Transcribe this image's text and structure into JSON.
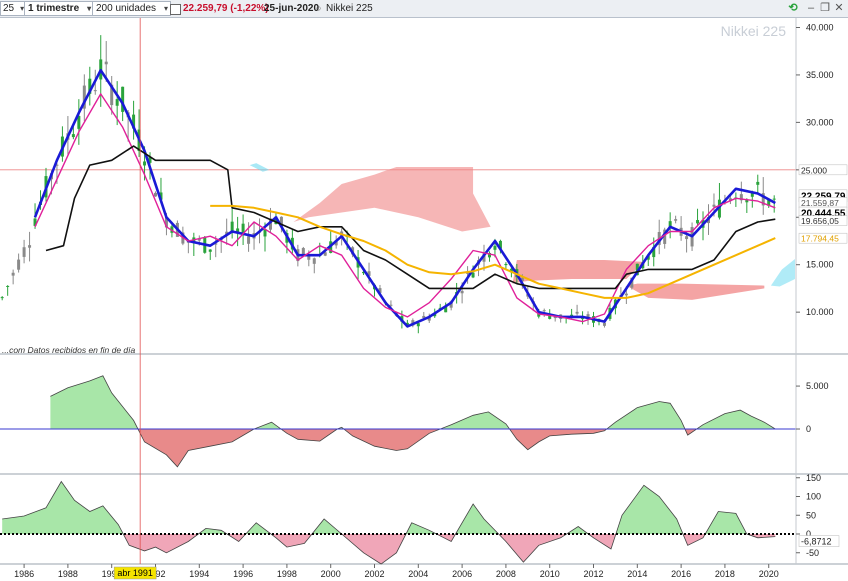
{
  "toolbar": {
    "prefix": "25",
    "period": "1 trimestre",
    "units": "200 unidades",
    "quote": "22.259,79 (-1,22%)",
    "date": "25-jun-2020",
    "instrument": "Nikkei 225"
  },
  "chart_data": [
    {
      "type": "line",
      "title": "Nikkei 225",
      "note": "...com  Datos recibidos en fin de día",
      "x_ticks": [
        "1986",
        "1988",
        "1990",
        "1992",
        "1994",
        "1996",
        "1998",
        "2000",
        "2002",
        "2004",
        "2006",
        "2008",
        "2010",
        "2012",
        "2014",
        "2016",
        "2018",
        "2020"
      ],
      "cursor_label": "abr 1991",
      "ylim": [
        5800,
        41000
      ],
      "y_ticks": [
        "40.000",
        "35.000",
        "30.000",
        "25.000",
        "20.000",
        "15.000",
        "10.000"
      ],
      "horizontal_line": 25000,
      "price_labels": [
        {
          "text": "25.000",
          "value": 25000,
          "bg": "#ffffff",
          "fg": "#222222"
        },
        {
          "text": "22.259,79",
          "value": 22260,
          "bg": "#ffffff",
          "fg": "#000000",
          "bold": true
        },
        {
          "text": "21.559,87",
          "value": 21560,
          "bg": "#ffffff",
          "fg": "#555555"
        },
        {
          "text": "20.444,55",
          "value": 20445,
          "bg": "#ffffff",
          "fg": "#000000",
          "bold": true
        },
        {
          "text": "19.656,05",
          "value": 19656,
          "bg": "#ffffff",
          "fg": "#333333"
        },
        {
          "text": "17.794,45",
          "value": 17794,
          "bg": "#ffffff",
          "fg": "#e0a000"
        }
      ],
      "series": [
        {
          "color": "#1a1ad6",
          "values": [
            [
              1986.5,
              20000
            ],
            [
              1987.5,
              26000
            ],
            [
              1988.5,
              31000
            ],
            [
              1989.5,
              35500
            ],
            [
              1990.5,
              32000
            ],
            [
              1991.5,
              27000
            ],
            [
              1992.5,
              20000
            ],
            [
              1993.5,
              17500
            ],
            [
              1994.5,
              17000
            ],
            [
              1995.5,
              18500
            ],
            [
              1996.5,
              18000
            ],
            [
              1997.5,
              20000
            ],
            [
              1998.5,
              16000
            ],
            [
              1999.5,
              16000
            ],
            [
              2000.5,
              18000
            ],
            [
              2001.5,
              14500
            ],
            [
              2002.5,
              11000
            ],
            [
              2003.5,
              8500
            ],
            [
              2004.5,
              9500
            ],
            [
              2005.5,
              11000
            ],
            [
              2006.5,
              14500
            ],
            [
              2007.5,
              17500
            ],
            [
              2008.5,
              14000
            ],
            [
              2009.5,
              10000
            ],
            [
              2010.5,
              9500
            ],
            [
              2011.5,
              9500
            ],
            [
              2012.5,
              9000
            ],
            [
              2013.5,
              12500
            ],
            [
              2014.5,
              16000
            ],
            [
              2015.5,
              19000
            ],
            [
              2016.5,
              18000
            ],
            [
              2017.5,
              20500
            ],
            [
              2018.5,
              23000
            ],
            [
              2019.5,
              22500
            ],
            [
              2020.3,
              21500
            ]
          ]
        },
        {
          "color": "#e0209a",
          "values": [
            [
              1986.5,
              19000
            ],
            [
              1987.5,
              24000
            ],
            [
              1988.5,
              29000
            ],
            [
              1989.5,
              33000
            ],
            [
              1990.5,
              29500
            ],
            [
              1991.5,
              24500
            ],
            [
              1992.5,
              19000
            ],
            [
              1993.5,
              17500
            ],
            [
              1994.5,
              18000
            ],
            [
              1995.5,
              17000
            ],
            [
              1996.5,
              19500
            ],
            [
              1997.5,
              18000
            ],
            [
              1998.5,
              15500
            ],
            [
              1999.5,
              17000
            ],
            [
              2000.5,
              16000
            ],
            [
              2001.5,
              12500
            ],
            [
              2002.5,
              10500
            ],
            [
              2003.5,
              9500
            ],
            [
              2004.5,
              11000
            ],
            [
              2005.5,
              13500
            ],
            [
              2006.5,
              16500
            ],
            [
              2007.5,
              16000
            ],
            [
              2008.5,
              11500
            ],
            [
              2009.5,
              9800
            ],
            [
              2010.5,
              9500
            ],
            [
              2011.5,
              9000
            ],
            [
              2012.5,
              9800
            ],
            [
              2013.5,
              14500
            ],
            [
              2014.5,
              17000
            ],
            [
              2015.5,
              18500
            ],
            [
              2016.5,
              18500
            ],
            [
              2017.5,
              21000
            ],
            [
              2018.5,
              22000
            ],
            [
              2019.5,
              21700
            ],
            [
              2020.3,
              21000
            ]
          ]
        },
        {
          "color": "#111111",
          "values": [
            [
              1987,
              16500
            ],
            [
              1987.8,
              17000
            ],
            [
              1988.3,
              22000
            ],
            [
              1989,
              25500
            ],
            [
              1990,
              26000
            ],
            [
              1991,
              27500
            ],
            [
              1992,
              26000
            ],
            [
              1993,
              26000
            ],
            [
              1994.5,
              26000
            ],
            [
              1995.3,
              25000
            ],
            [
              1995.5,
              21000
            ],
            [
              1996.5,
              20500
            ],
            [
              1997.5,
              19500
            ],
            [
              1998.5,
              18500
            ],
            [
              1999.5,
              19000
            ],
            [
              2000.5,
              19000
            ],
            [
              2001.5,
              16500
            ],
            [
              2002.5,
              15500
            ],
            [
              2003.5,
              14000
            ],
            [
              2004.5,
              12500
            ],
            [
              2005.5,
              12500
            ],
            [
              2006.5,
              12500
            ],
            [
              2007.5,
              14000
            ],
            [
              2008.5,
              13000
            ],
            [
              2009.5,
              12500
            ],
            [
              2010.5,
              12500
            ],
            [
              2011.5,
              12500
            ],
            [
              2012.5,
              12500
            ],
            [
              2013,
              12500
            ],
            [
              2013.5,
              14000
            ],
            [
              2014.5,
              14500
            ],
            [
              2015.5,
              14500
            ],
            [
              2016.5,
              14500
            ],
            [
              2017.5,
              15500
            ],
            [
              2018.5,
              18500
            ],
            [
              2019.5,
              19500
            ],
            [
              2020.3,
              19800
            ]
          ]
        },
        {
          "color": "#f5b400",
          "values": [
            [
              1994.5,
              21200
            ],
            [
              1995.5,
              21200
            ],
            [
              1996.5,
              21000
            ],
            [
              1997.5,
              20500
            ],
            [
              1998.5,
              20000
            ],
            [
              1999.5,
              19000
            ],
            [
              2000.5,
              18200
            ],
            [
              2001.5,
              17500
            ],
            [
              2002.5,
              16500
            ],
            [
              2003.5,
              15000
            ],
            [
              2004.5,
              14200
            ],
            [
              2005.5,
              14000
            ],
            [
              2006.5,
              14300
            ],
            [
              2007.5,
              15000
            ],
            [
              2008.5,
              14000
            ],
            [
              2009.5,
              13000
            ],
            [
              2010.5,
              12500
            ],
            [
              2011.5,
              12000
            ],
            [
              2012.5,
              11500
            ],
            [
              2013.5,
              11500
            ],
            [
              2014.5,
              12000
            ],
            [
              2015.5,
              13000
            ],
            [
              2016.5,
              14000
            ],
            [
              2017.5,
              15000
            ],
            [
              2018.5,
              16000
            ],
            [
              2019.5,
              17000
            ],
            [
              2020.3,
              17800
            ]
          ]
        }
      ]
    },
    {
      "type": "area",
      "y_ticks": [
        "5.000",
        "0"
      ],
      "ylim": [
        -5000,
        8500
      ],
      "baseline": 0,
      "values": [
        [
          1987.2,
          3800
        ],
        [
          1988,
          4800
        ],
        [
          1989,
          5600
        ],
        [
          1989.6,
          6200
        ],
        [
          1990,
          4200
        ],
        [
          1991,
          1000
        ],
        [
          1991.5,
          -1500
        ],
        [
          1992.5,
          -3000
        ],
        [
          1993,
          -4400
        ],
        [
          1993.5,
          -2500
        ],
        [
          1994.5,
          -2000
        ],
        [
          1995.5,
          -1500
        ],
        [
          1996.5,
          0
        ],
        [
          1997.3,
          800
        ],
        [
          1998,
          -500
        ],
        [
          1998.5,
          -1200
        ],
        [
          1999.5,
          -1400
        ],
        [
          2000.3,
          0
        ],
        [
          2000.5,
          200
        ],
        [
          2001,
          -800
        ],
        [
          2002,
          -2000
        ],
        [
          2003,
          -2500
        ],
        [
          2003.5,
          -2300
        ],
        [
          2004.5,
          -500
        ],
        [
          2005.5,
          500
        ],
        [
          2006.5,
          1600
        ],
        [
          2007.2,
          2000
        ],
        [
          2008,
          600
        ],
        [
          2008.5,
          -1200
        ],
        [
          2009,
          -2400
        ],
        [
          2009.5,
          -1500
        ],
        [
          2010,
          -800
        ],
        [
          2011,
          -600
        ],
        [
          2012,
          -500
        ],
        [
          2012.5,
          -200
        ],
        [
          2013,
          800
        ],
        [
          2014,
          2500
        ],
        [
          2015,
          3200
        ],
        [
          2015.5,
          3000
        ],
        [
          2016,
          1000
        ],
        [
          2016.3,
          -700
        ],
        [
          2017,
          500
        ],
        [
          2018,
          1800
        ],
        [
          2018.7,
          2200
        ],
        [
          2019.2,
          1500
        ],
        [
          2019.8,
          800
        ],
        [
          2020.3,
          0
        ]
      ],
      "pos_color": "#a8e6a8",
      "neg_color": "#e88a8a"
    },
    {
      "type": "area",
      "y_ticks": [
        "150",
        "100",
        "50",
        "0",
        "-50"
      ],
      "ylim": [
        -80,
        160
      ],
      "baseline": 0,
      "value_label": "-6,8712",
      "values": [
        [
          1985,
          40
        ],
        [
          1986,
          48
        ],
        [
          1987,
          70
        ],
        [
          1987.7,
          140
        ],
        [
          1988.3,
          90
        ],
        [
          1989,
          60
        ],
        [
          1989.6,
          75
        ],
        [
          1990.3,
          25
        ],
        [
          1990.8,
          -30
        ],
        [
          1991.5,
          -45
        ],
        [
          1992,
          -35
        ],
        [
          1992.5,
          -50
        ],
        [
          1993.5,
          -20
        ],
        [
          1994.3,
          15
        ],
        [
          1995,
          10
        ],
        [
          1995.8,
          -20
        ],
        [
          1996.6,
          30
        ],
        [
          1997.5,
          -10
        ],
        [
          1998,
          -35
        ],
        [
          1998.8,
          -25
        ],
        [
          1999.7,
          40
        ],
        [
          2000.5,
          0
        ],
        [
          2001.5,
          -50
        ],
        [
          2002.3,
          -80
        ],
        [
          2003,
          -50
        ],
        [
          2003.7,
          30
        ],
        [
          2004.5,
          10
        ],
        [
          2005.5,
          -20
        ],
        [
          2006.5,
          80
        ],
        [
          2007,
          40
        ],
        [
          2008,
          -20
        ],
        [
          2008.8,
          -75
        ],
        [
          2009.5,
          -30
        ],
        [
          2010.5,
          -10
        ],
        [
          2011.3,
          20
        ],
        [
          2012,
          -10
        ],
        [
          2012.8,
          -40
        ],
        [
          2013.3,
          50
        ],
        [
          2014.3,
          130
        ],
        [
          2015,
          100
        ],
        [
          2015.8,
          40
        ],
        [
          2016.3,
          -30
        ],
        [
          2017,
          -10
        ],
        [
          2017.7,
          60
        ],
        [
          2018.5,
          55
        ],
        [
          2019,
          0
        ],
        [
          2019.5,
          -10
        ],
        [
          2020.3,
          -7
        ]
      ],
      "pos_color": "#a8e6a8",
      "neg_color": "#f0a6b8"
    }
  ],
  "colors": {
    "cloud_red": "#f08585",
    "cloud_green": "#6fdaf0",
    "candle_up": "#2aa33c",
    "candle_down": "#8a8a8a",
    "cursor": "#e05050"
  }
}
